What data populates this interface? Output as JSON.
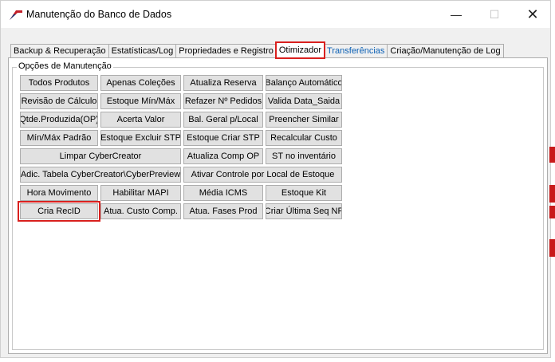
{
  "window": {
    "title": "Manutenção do Banco de Dados",
    "minimize": "—",
    "maximize": "☐",
    "close": "✕"
  },
  "tabs": [
    {
      "label": "Backup & Recuperação"
    },
    {
      "label": "Estatísticas/Log"
    },
    {
      "label": "Propriedades e Registro"
    },
    {
      "label": "Otimizador"
    },
    {
      "label": "Transferências"
    },
    {
      "label": "Criação/Manutenção de Log"
    }
  ],
  "group": {
    "title": "Opções de Manutenção",
    "buttons": [
      "Todos Produtos",
      "Apenas Coleções",
      "Atualiza Reserva",
      "Balanço Automático",
      "Revisão de Cálculo",
      "Estoque Mín/Máx",
      "Refazer Nº Pedidos",
      "Valida Data_Saida",
      "Qtde.Produzida(OP)",
      "Acerta Valor",
      "Bal. Geral p/Local",
      "Preencher Similar",
      "Mín/Máx Padrão",
      "Estoque Excluir STP",
      "Estoque Criar STP",
      "Recalcular Custo",
      "Limpar CyberCreator",
      "Atualiza Comp OP",
      "ST no inventário",
      "Adic. Tabela CyberCreator\\CyberPreview",
      "Ativar Controle por Local de Estoque",
      "Hora Movimento",
      "Habilitar MAPI",
      "Média ICMS",
      "Estoque Kit",
      "Cria RecID",
      "Atua. Custo Comp.",
      "Atua. Fases Prod",
      "Criar Última Seq NF"
    ]
  },
  "colors": {
    "highlight": "#d9201e",
    "tab_blue_text": "#0a5fb4",
    "button_face": "#e1e1e1"
  }
}
